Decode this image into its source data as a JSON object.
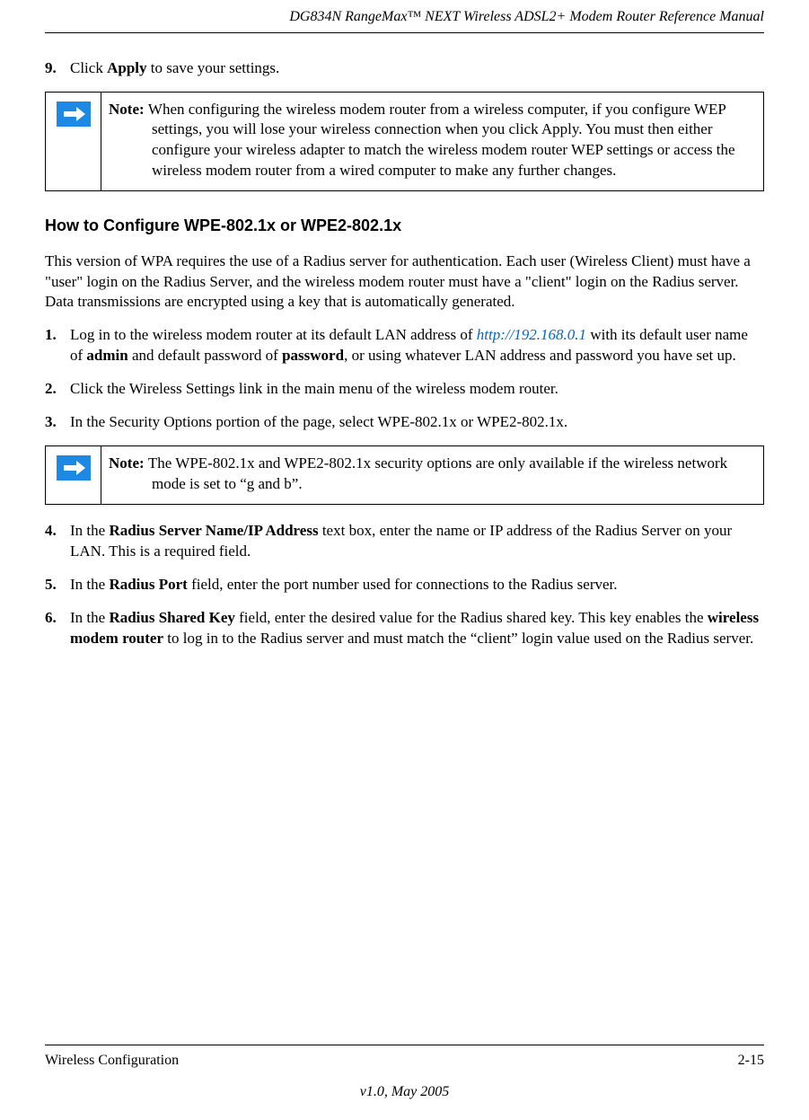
{
  "header": {
    "title": "DG834N RangeMax™ NEXT Wireless ADSL2+ Modem Router Reference Manual"
  },
  "step9": {
    "num": "9.",
    "pre": "Click ",
    "bold1": "Apply",
    "post": " to save your settings."
  },
  "note1": {
    "label": "Note: ",
    "text": "When configuring the wireless modem router from a wireless computer, if you configure WEP settings, you will lose your wireless connection when you click Apply. You must then either configure your wireless adapter to match the wireless modem router WEP settings or access the wireless modem router from a wired computer to make any further changes."
  },
  "section": {
    "heading": "How to Configure WPE-802.1x or WPE2-802.1x",
    "intro": "This version of WPA requires the use of a Radius server for authentication. Each user (Wireless Client) must have a \"user\" login on the Radius Server, and the wireless modem router must have a \"client\" login on the Radius server. Data transmissions are encrypted using a key that is automatically generated."
  },
  "step1": {
    "num": "1.",
    "pre": "Log in to the wireless modem router at its default LAN address of ",
    "link": "http://192.168.0.1",
    "mid1": " with its default user name of ",
    "bold1": "admin",
    "mid2": " and default password of ",
    "bold2": "password",
    "post": ", or using whatever LAN address and password you have set up."
  },
  "step2": {
    "num": "2.",
    "text": "Click the Wireless Settings link in the main menu of the wireless modem router."
  },
  "step3": {
    "num": "3.",
    "text": "In the Security Options portion of the page, select WPE-802.1x or WPE2-802.1x."
  },
  "note2": {
    "label": "Note: ",
    "text": "The WPE-802.1x and WPE2-802.1x security options are only available if the wireless network mode is set to “g and b”."
  },
  "step4": {
    "num": "4.",
    "pre": "In the ",
    "bold1": "Radius Server Name/IP Address",
    "post": " text box, enter the name or IP address of the Radius Server on your LAN. This is a required field."
  },
  "step5": {
    "num": "5.",
    "pre": "In the ",
    "bold1": "Radius Port",
    "post": " field, enter the port number used for connections to the Radius server."
  },
  "step6": {
    "num": "6.",
    "pre": "In the ",
    "bold1": "Radius Shared Key",
    "mid1": " field, enter the desired value for the Radius shared key. This key enables the ",
    "bold2": "wireless modem router",
    "post": " to log in to the Radius server and must match the “client” login value used on the Radius server."
  },
  "footer": {
    "left": "Wireless Configuration",
    "right": "2-15",
    "version": "v1.0, May 2005"
  }
}
